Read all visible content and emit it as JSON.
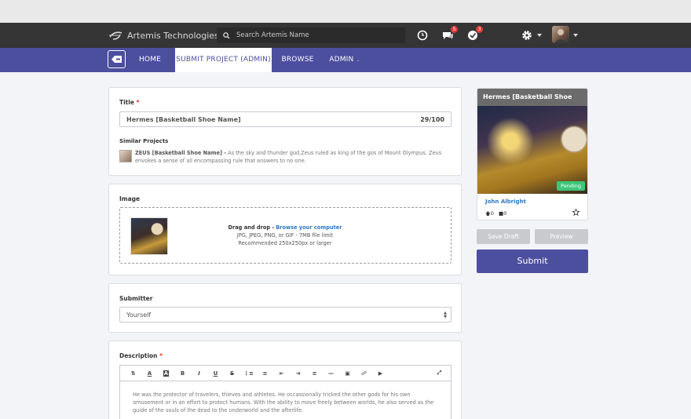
{
  "header": {
    "brand": "Artemis Technologies",
    "search_placeholder": "Search Artemis Name",
    "chat_badge": "5",
    "notif_badge": "3"
  },
  "nav": {
    "items": [
      "HOME",
      "SUBMIT PROJECT (ADMIN)",
      "BROWSE",
      "ADMIN"
    ],
    "active_index": 1
  },
  "form": {
    "title_label": "Title",
    "title_value": "Hermes [Basketball Shoe Name]",
    "title_count": "29/100",
    "similar_label": "Similar Projects",
    "similar_item_name": "ZEUS [Basketball Shoe Name] -",
    "similar_item_desc": "As the sky and thunder god,Zeus ruled as king of the gos of Mount Olympus. Zeus envokes a sense of all encompassing rule that answers to no one.",
    "image_label": "Image",
    "dz_drag": "Drag and drop -",
    "dz_browse": "Browse your computer",
    "dz_types": "JPG, JPEG, PNG, or GIF - 7MB file limit",
    "dz_rec": "Recommended 250x250px or larger",
    "submitter_label": "Submitter",
    "submitter_value": "Yourself",
    "description_label": "Description",
    "description_text": "He was the protector of travelers, thieves and athletes. He occassionally tricked the other gods for his own amusement or in an effort to protect humans. With the ability to move freely between worlds, he also served as the guide of the souls of the dead to the underworld and the afterlife."
  },
  "preview": {
    "title": "Hermes [Basketball Shoe Name]",
    "status": "Pending",
    "author": "John Albright",
    "upvotes": "0",
    "comments": "0"
  },
  "actions": {
    "save_draft": "Save Draft",
    "preview": "Preview",
    "submit": "Submit"
  },
  "colors": {
    "primary": "#4c4e9e",
    "topbar": "#353535",
    "link": "#2f79c2",
    "pending": "#3ec67a",
    "required": "#d9302b"
  }
}
